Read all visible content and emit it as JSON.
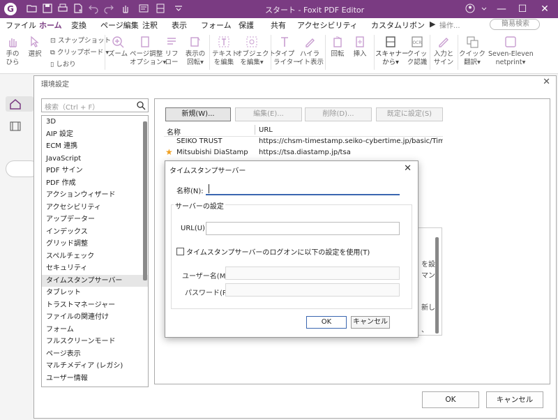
{
  "window": {
    "title": "スタート - Foxit PDF Editor",
    "app_icon_letter": "G"
  },
  "menu": {
    "items": [
      "ファイル",
      "ホーム",
      "変換",
      "ページ編集",
      "注釈",
      "表示",
      "フォーム",
      "保護",
      "共有",
      "アクセシビリティ",
      "カスタムリボン"
    ],
    "active": "ホーム",
    "search_tip": "操作...",
    "search_help": "簡易検索"
  },
  "ribbon": {
    "hand": "手の\nひら",
    "select": "選択",
    "snapshot": "スナップショット",
    "clipboard": "クリップボード ▾",
    "bookmark": "しおり",
    "zoom": "ズーム",
    "page_fit": "ページ調整\nオプション▾",
    "reflow": "リフ\nロー",
    "rotate_view": "表示の\n回転▾",
    "edit_text": "テキスト\nを編集",
    "edit_object": "オブジェクト\nを編集▾",
    "typewriter": "タイプ\nライター",
    "highlight": "ハイラ\nイト表示",
    "rotate": "回転",
    "insert": "挿入",
    "scanner": "スキャナー\nから▾",
    "quick_ocr": "クイッ\nク認識",
    "fill_sign": "入力と\nサイン",
    "quick_translate": "クイック\n翻訳▾",
    "seven_eleven": "Seven-Eleven\nnetprint▾"
  },
  "preferences": {
    "title": "環境設定",
    "search_placeholder": "検索（Ctrl + F）",
    "categories": [
      "3D",
      "AIP 設定",
      "ECM 連携",
      "JavaScript",
      "PDF サイン",
      "PDF 作成",
      "アクションウィザード",
      "アクセシビリティ",
      "アップデーター",
      "インデックス",
      "グリッド調整",
      "スペルチェック",
      "セキュリティ",
      "タイムスタンプサーバー",
      "タブレット",
      "トラストマネージャー",
      "ファイルの関連付け",
      "フォーム",
      "フルスクリーンモード",
      "ページ表示",
      "マルチメディア (レガシ)",
      "ユーザー情報"
    ],
    "selected_category": "タイムスタンプサーバー",
    "buttons": {
      "new": "新規(W)...",
      "edit": "編集(E)...",
      "delete": "削除(D)...",
      "set_default": "既定に設定(S)"
    },
    "table": {
      "col_name": "名称",
      "col_url": "URL",
      "rows": [
        {
          "name": "SEIKO TRUST",
          "url": "https://chsm-timestamp.seiko-cybertime.jp/basic/Timestamp...",
          "default": false
        },
        {
          "name": "Mitsubishi DiaStamp",
          "url": "https://tsa.diastamp.jp/tsa",
          "default": true
        }
      ]
    },
    "partial_texts": [
      "を設",
      "マン",
      "新し",
      "、"
    ],
    "ok": "OK",
    "cancel": "キャンセル"
  },
  "ts_dialog": {
    "title": "タイムスタンプサーバー",
    "name_label": "名称(N):",
    "name_value": "",
    "server_group": "サーバーの設定",
    "url_label": "URL(U):",
    "url_value": "",
    "logon_checkbox": "タイムスタンプサーバーのログオンに以下の設定を使用(T)",
    "logon_checked": false,
    "user_label": "ユーザー名(M):",
    "password_label": "パスワード(P):",
    "ok": "OK",
    "cancel": "キャンセル"
  },
  "colors": {
    "titlebar": "#7a3b82",
    "accent": "#3a66b0",
    "star": "#f0a020"
  }
}
